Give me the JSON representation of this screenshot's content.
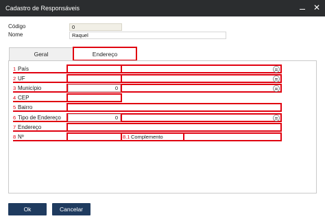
{
  "window": {
    "title": "Cadastro de Responsáveis"
  },
  "header": {
    "codigo_label": "Código",
    "codigo_value": "0",
    "nome_label": "Nome",
    "nome_value": "Raquel"
  },
  "tabs": [
    {
      "label": "Geral",
      "active": false
    },
    {
      "label": "Endereço",
      "active": true
    }
  ],
  "address": {
    "pais": {
      "num": "1",
      "label": "País"
    },
    "uf": {
      "num": "2",
      "label": "UF"
    },
    "municipio": {
      "num": "3",
      "label": "Município",
      "value": "0"
    },
    "cep": {
      "num": "4",
      "label": "CEP"
    },
    "bairro": {
      "num": "5",
      "label": "Bairro"
    },
    "tipo_endereco": {
      "num": "6",
      "label": "Tipo de Endereço",
      "value": "0"
    },
    "endereco": {
      "num": "7",
      "label": "Endereço"
    },
    "numero": {
      "num": "8",
      "label": "Nº"
    },
    "complemento": {
      "num": "8.1",
      "label": "Complemento"
    }
  },
  "buttons": {
    "ok": "Ok",
    "cancel": "Cancelar"
  },
  "colors": {
    "highlight": "#e0000f",
    "titlebar": "#2b2d2f",
    "button": "#1f3b5f"
  }
}
